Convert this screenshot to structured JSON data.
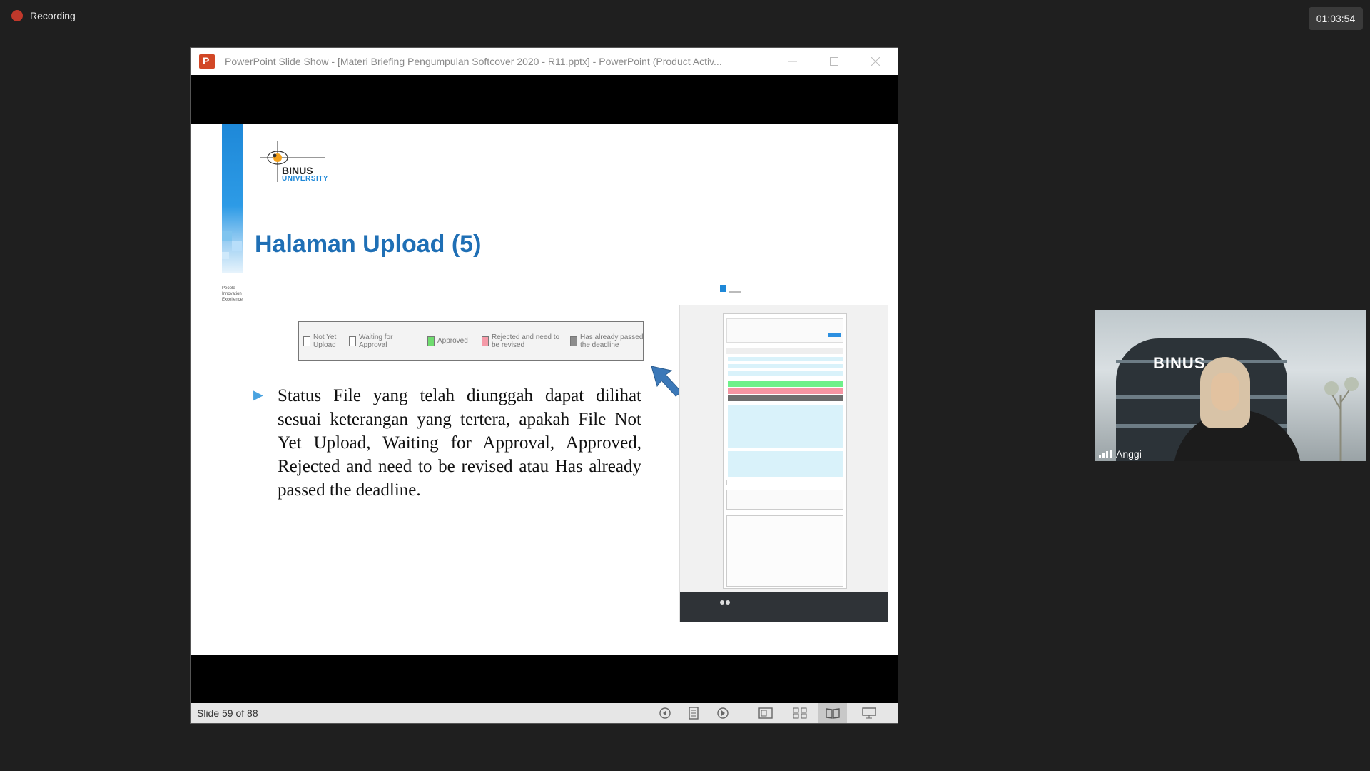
{
  "recording": {
    "label": "Recording"
  },
  "timer": {
    "value": "01:03:54"
  },
  "window": {
    "title": "PowerPoint Slide Show - [Materi Briefing Pengumpulan Softcover 2020 - R11.pptx] - PowerPoint (Product Activ...",
    "minimize_icon": "minimize-icon",
    "maximize_icon": "maximize-icon",
    "close_icon": "close-icon"
  },
  "slide": {
    "logo_line1": "BINUS",
    "logo_line2": "UNIVERSITY",
    "tagline": "People Innovation Excellence",
    "title": "Halaman Upload (5)",
    "legend": [
      {
        "label": "Not Yet Upload",
        "color": "#ffffff"
      },
      {
        "label": "Waiting for Approval",
        "color": "#ffffff"
      },
      {
        "label": "Approved",
        "color": "#6fdc6f"
      },
      {
        "label": "Rejected and need to be revised",
        "color": "#f59aa8"
      },
      {
        "label": "Has already passed the deadline",
        "color": "#8c8c8c"
      }
    ],
    "body": "Status File yang telah diunggah dapat dilihat sesuai keterangan yang tertera, apakah File Not Yet Upload, Waiting for Approval, Approved, Rejected and need to be revised atau Has already passed the deadline."
  },
  "statusbar": {
    "slide_count": "Slide 59 of 88"
  },
  "participant": {
    "name": "Anggi",
    "background_sign": "BINUS"
  }
}
